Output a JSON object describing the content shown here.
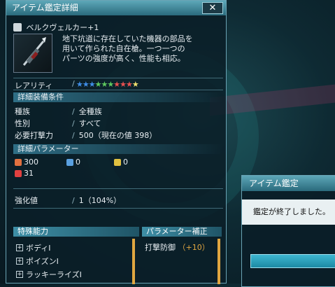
{
  "window": {
    "title": "アイテム鑑定詳細",
    "close_label": "✕"
  },
  "item": {
    "name": "ベルクヴェルカー+1",
    "description_lines": [
      "地下坑道に存在していた機器の部品を",
      "用いて作られた自在槍。一つ一つの",
      "パーツの強度が高く、性能も相応。"
    ]
  },
  "rarity": {
    "label": "レアリティ",
    "stars": [
      "#3f8ee8",
      "#3f8ee8",
      "#3f8ee8",
      "#5fc95f",
      "#5fc95f",
      "#5fc95f",
      "#e85050",
      "#e85050",
      "#e85050",
      "#f0e070"
    ]
  },
  "requirements": {
    "header": "詳細装備条件",
    "rows": [
      {
        "label": "種族",
        "value": "全種族"
      },
      {
        "label": "性別",
        "value": "すべて"
      },
      {
        "label": "必要打撃力",
        "value": "500（現在の値 398）"
      }
    ]
  },
  "parameters": {
    "header": "詳細パラメーター",
    "items": [
      {
        "icon": "striking-attack-icon",
        "color": "#e07040",
        "value": "300"
      },
      {
        "icon": "ranged-attack-icon",
        "color": "#5aa0e0",
        "value": "0"
      },
      {
        "icon": "tech-attack-icon",
        "color": "#e0c040",
        "value": "0"
      },
      {
        "icon": "element-fire-icon",
        "color": "#e04040",
        "value": "31"
      }
    ]
  },
  "enhancement": {
    "label": "強化値",
    "value": "1（104%）"
  },
  "abilities": {
    "header": "特殊能力",
    "items": [
      "ボディI",
      "ポイズンI",
      "ラッキーライズI"
    ]
  },
  "param_correction": {
    "header": "パラメーター補正",
    "text": "打撃防御",
    "bonus": "（+10）"
  },
  "dialog": {
    "title": "アイテム鑑定",
    "message": "鑑定が終了しました。"
  }
}
